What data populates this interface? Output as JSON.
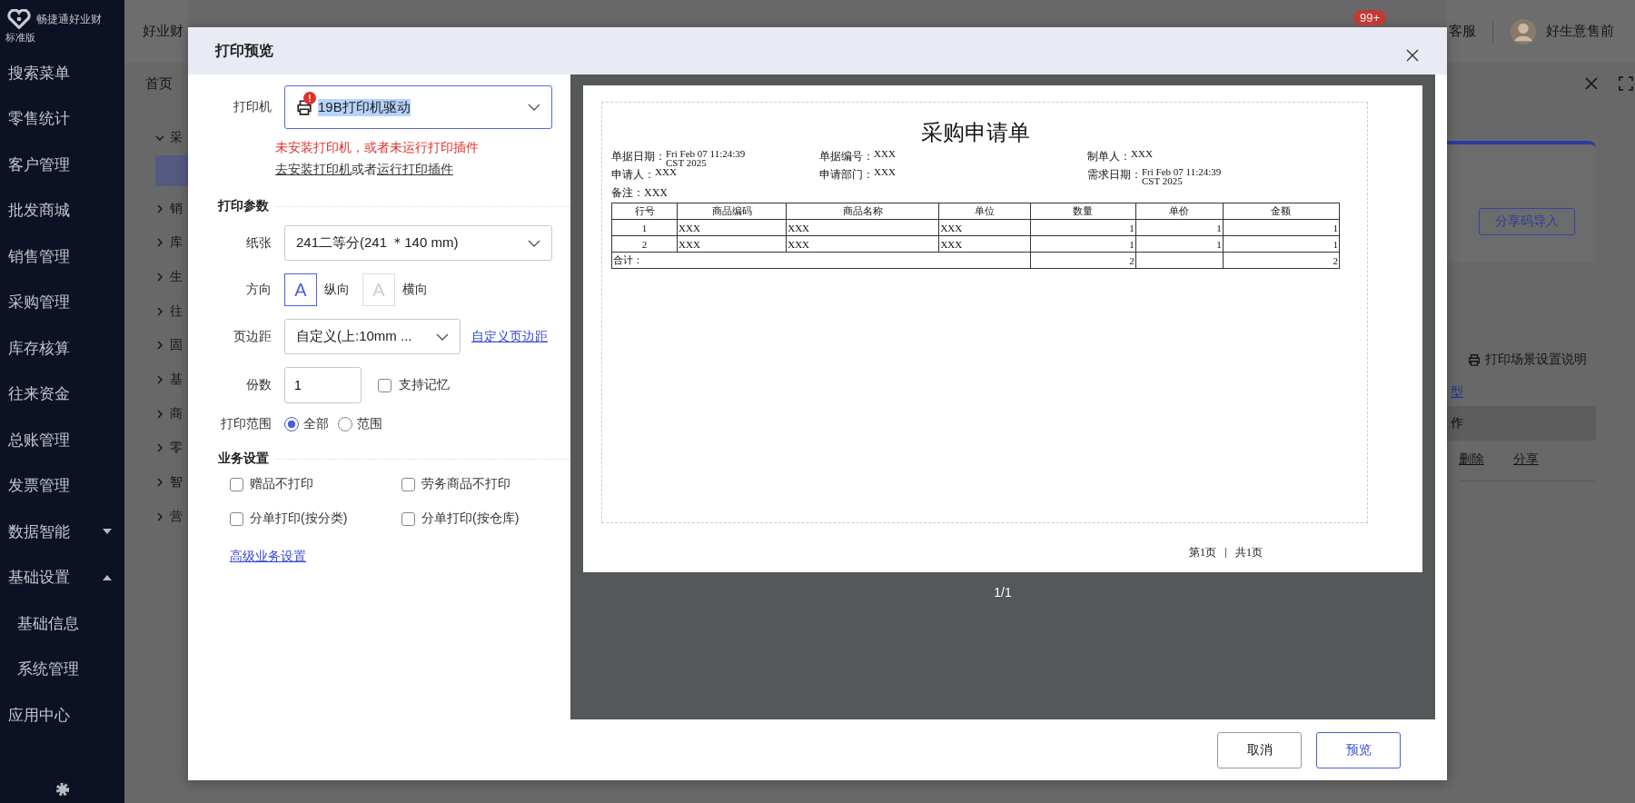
{
  "sidebar": {
    "brand": "畅捷通好业财",
    "edition": "标准版",
    "items": [
      {
        "label": "搜索菜单"
      },
      {
        "label": "零售统计"
      },
      {
        "label": "客户管理"
      },
      {
        "label": "批发商城"
      },
      {
        "label": "销售管理"
      },
      {
        "label": "采购管理"
      },
      {
        "label": "库存核算"
      },
      {
        "label": "往来资金"
      },
      {
        "label": "总账管理"
      },
      {
        "label": "发票管理"
      },
      {
        "label": "数据智能",
        "expanded": false
      },
      {
        "label": "基础设置",
        "expanded": true,
        "children": [
          {
            "label": "基础信息"
          },
          {
            "label": "系统管理"
          }
        ]
      },
      {
        "label": "应用中心"
      }
    ]
  },
  "top_tab": "好业财",
  "home_tab": "首页",
  "tree": [
    {
      "label": "采",
      "expanded": true
    },
    {
      "label": "销",
      "expanded": false
    },
    {
      "label": "库",
      "expanded": false
    },
    {
      "label": "生",
      "expanded": false
    },
    {
      "label": "往",
      "expanded": false
    },
    {
      "label": "固",
      "expanded": false
    },
    {
      "label": "基",
      "expanded": false
    },
    {
      "label": "商",
      "expanded": false
    },
    {
      "label": "零",
      "expanded": false
    },
    {
      "label": "智",
      "expanded": false
    },
    {
      "label": "营",
      "expanded": false
    }
  ],
  "notification_badge": "99+",
  "support": "客服",
  "user_name": "好生意售前",
  "right_panel": {
    "import_button": "分享码导入",
    "print_help": "打印场景设置说明",
    "link_fragment": "型",
    "header_fragment": "作",
    "row_actions": [
      "删除",
      "分享"
    ]
  },
  "dialog": {
    "title": "打印预览",
    "printer": {
      "label": "打印机",
      "value": "19B打印机驱动",
      "alert": "!",
      "text_selected": true,
      "error": "未安装打印机，或者未运行打印插件",
      "install_link": "去安装打印机",
      "joiner": "或者",
      "plugin_link": "运行打印插件"
    },
    "params_heading": "打印参数",
    "paper": {
      "label": "纸张",
      "value": "241二等分(241 ＊140  mm)"
    },
    "orientation": {
      "label": "方向",
      "options": [
        {
          "glyph": "A",
          "label": "纵向",
          "selected": true
        },
        {
          "glyph": "A",
          "label": "横向",
          "selected": false
        }
      ]
    },
    "margin": {
      "label": "页边距",
      "value": "自定义(上:10mm  ...",
      "link": "自定义页边距"
    },
    "copies": {
      "label": "份数",
      "value": "1",
      "remember": {
        "label": "支持记忆",
        "checked": false
      }
    },
    "range": {
      "label": "打印范围",
      "options": [
        {
          "label": "全部",
          "selected": true
        },
        {
          "label": "范围",
          "selected": false
        }
      ]
    },
    "business_heading": "业务设置",
    "business_options": [
      {
        "label": "赠品不打印",
        "checked": false
      },
      {
        "label": "劳务商品不打印",
        "checked": false
      },
      {
        "label": "分单打印(按分类)",
        "checked": false
      },
      {
        "label": "分单打印(按仓库)",
        "checked": false
      }
    ],
    "advanced_link": "高级业务设置",
    "document": {
      "title": "采购申请单",
      "fields": [
        {
          "label": "单据日期：",
          "value": "Fri Feb 07 11:24:39 CST 2025"
        },
        {
          "label": "单据编号：",
          "value": "XXX"
        },
        {
          "label": "制单人：",
          "value": "XXX"
        },
        {
          "label": "申请人：",
          "value": "XXX"
        },
        {
          "label": "申请部门：",
          "value": "XXX"
        },
        {
          "label": "需求日期：",
          "value": "Fri Feb 07 11:24:39 CST 2025"
        }
      ],
      "remark": "备注：XXX",
      "columns": [
        "行号",
        "商品编码",
        "商品名称",
        "单位",
        "数量",
        "单价",
        "金额"
      ],
      "rows": [
        [
          "1",
          "XXX",
          "XXX",
          "XXX",
          "1",
          "1",
          "1"
        ],
        [
          "2",
          "XXX",
          "XXX",
          "XXX",
          "1",
          "1",
          "1"
        ]
      ],
      "total": {
        "label": "合计：",
        "quantity": "2",
        "amount": "2"
      },
      "page": "第1页",
      "pages": "共1页"
    },
    "pager": "1/1",
    "buttons": [
      {
        "label": "取消",
        "kind": "default"
      },
      {
        "label": "预览",
        "kind": "primary"
      }
    ]
  }
}
